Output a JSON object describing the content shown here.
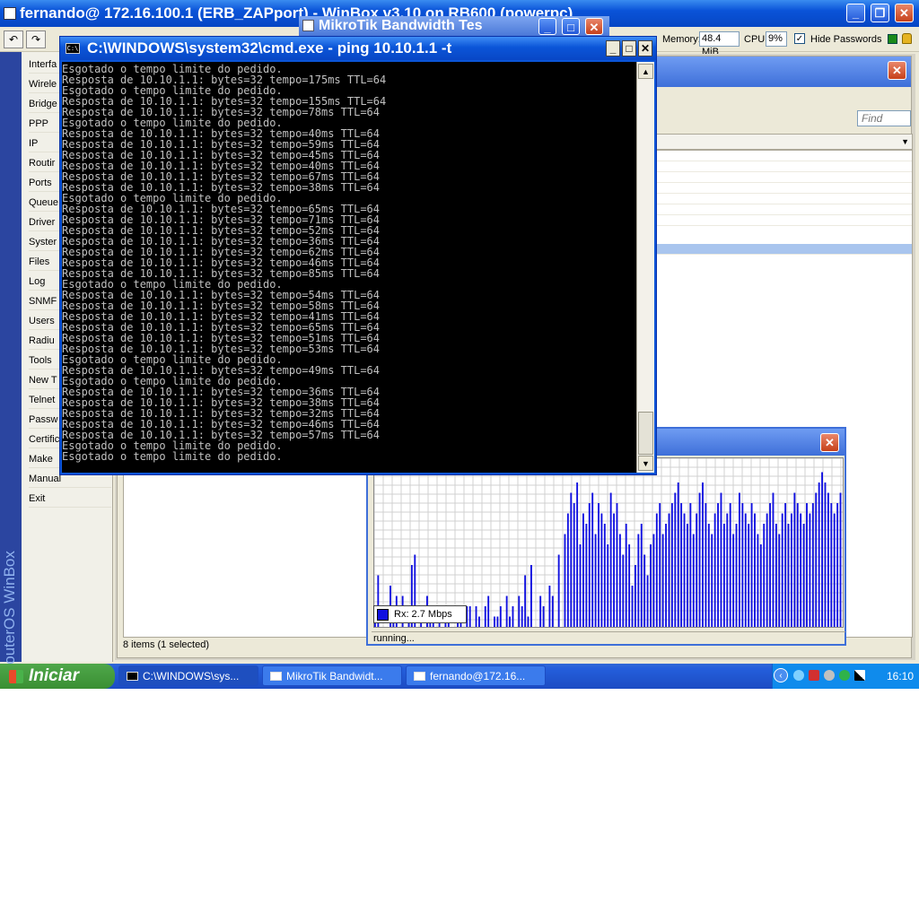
{
  "winbox": {
    "title": "fernando@ 172.16.100.1 (ERB_ZAPport) - WinBox v3.10 on RB600 (powerpc)",
    "toolbar": {
      "undo_icon": "undo-icon",
      "redo_icon": "redo-icon",
      "memory_label": "Memory:",
      "memory_value": "48.4 MiB",
      "cpu_label": "CPU:",
      "cpu_value": "9%",
      "hide_passwords_label": "Hide Passwords"
    },
    "brand": "RouterOS WinBox",
    "menu": [
      "Interfa",
      "Wirele",
      "Bridge",
      "PPP",
      "IP",
      "Routir",
      "Ports",
      "Queue",
      "Driver",
      "Syster",
      "Files",
      "Log",
      "SNMF",
      "Users",
      "Radiu",
      "Tools",
      "New T",
      "Telnet",
      "Passw",
      "Certific",
      "Make",
      "Manual",
      "Exit"
    ],
    "list": {
      "find_placeholder": "Find",
      "status": "8 items (1 selected)"
    }
  },
  "bandwidth": {
    "title": "MikroTik Bandwidth Tes",
    "legend": "Rx: 2.7 Mbps",
    "status": "running...",
    "colors": {
      "bar": "#1010e0",
      "grid": "#d0d0d0"
    },
    "chart_data": {
      "type": "bar",
      "series": [
        {
          "name": "Rx: 2.7 Mbps",
          "values": [
            2,
            5,
            0,
            0,
            0,
            4,
            1,
            3,
            0,
            3,
            0,
            1,
            6,
            7,
            0,
            2,
            0,
            3,
            1,
            2,
            0,
            1,
            0,
            2,
            1,
            0,
            0,
            1,
            1,
            0,
            2,
            2,
            0,
            2,
            1,
            0,
            2,
            3,
            0,
            1,
            1,
            2,
            0,
            3,
            1,
            2,
            0,
            3,
            2,
            5,
            1,
            6,
            0,
            0,
            3,
            2,
            0,
            4,
            3,
            0,
            7,
            0,
            9,
            11,
            13,
            12,
            14,
            8,
            11,
            10,
            12,
            13,
            9,
            12,
            11,
            10,
            8,
            13,
            11,
            12,
            9,
            7,
            10,
            8,
            4,
            6,
            9,
            10,
            7,
            5,
            8,
            9,
            11,
            12,
            9,
            10,
            11,
            12,
            13,
            14,
            12,
            11,
            10,
            12,
            9,
            11,
            13,
            14,
            12,
            10,
            9,
            11,
            12,
            13,
            10,
            11,
            12,
            9,
            10,
            13,
            12,
            11,
            10,
            12,
            11,
            9,
            8,
            10,
            11,
            12,
            13,
            10,
            9,
            11,
            12,
            10,
            11,
            13,
            12,
            11,
            10,
            12,
            11,
            12,
            13,
            14,
            15,
            14,
            13,
            12,
            11,
            12,
            13
          ]
        }
      ],
      "ylim": [
        0,
        16
      ]
    }
  },
  "cmd": {
    "title": "C:\\WINDOWS\\system32\\cmd.exe - ping 10.10.1.1 -t",
    "lines": [
      "Esgotado o tempo limite do pedido.",
      "Resposta de 10.10.1.1: bytes=32 tempo=175ms TTL=64",
      "Esgotado o tempo limite do pedido.",
      "Resposta de 10.10.1.1: bytes=32 tempo=155ms TTL=64",
      "Resposta de 10.10.1.1: bytes=32 tempo=78ms TTL=64",
      "Esgotado o tempo limite do pedido.",
      "Resposta de 10.10.1.1: bytes=32 tempo=40ms TTL=64",
      "Resposta de 10.10.1.1: bytes=32 tempo=59ms TTL=64",
      "Resposta de 10.10.1.1: bytes=32 tempo=45ms TTL=64",
      "Resposta de 10.10.1.1: bytes=32 tempo=40ms TTL=64",
      "Resposta de 10.10.1.1: bytes=32 tempo=67ms TTL=64",
      "Resposta de 10.10.1.1: bytes=32 tempo=38ms TTL=64",
      "Esgotado o tempo limite do pedido.",
      "Resposta de 10.10.1.1: bytes=32 tempo=65ms TTL=64",
      "Resposta de 10.10.1.1: bytes=32 tempo=71ms TTL=64",
      "Resposta de 10.10.1.1: bytes=32 tempo=52ms TTL=64",
      "Resposta de 10.10.1.1: bytes=32 tempo=36ms TTL=64",
      "Resposta de 10.10.1.1: bytes=32 tempo=62ms TTL=64",
      "Resposta de 10.10.1.1: bytes=32 tempo=46ms TTL=64",
      "Resposta de 10.10.1.1: bytes=32 tempo=85ms TTL=64",
      "Esgotado o tempo limite do pedido.",
      "Resposta de 10.10.1.1: bytes=32 tempo=54ms TTL=64",
      "Resposta de 10.10.1.1: bytes=32 tempo=58ms TTL=64",
      "Resposta de 10.10.1.1: bytes=32 tempo=41ms TTL=64",
      "Resposta de 10.10.1.1: bytes=32 tempo=65ms TTL=64",
      "Resposta de 10.10.1.1: bytes=32 tempo=51ms TTL=64",
      "Resposta de 10.10.1.1: bytes=32 tempo=53ms TTL=64",
      "Esgotado o tempo limite do pedido.",
      "Resposta de 10.10.1.1: bytes=32 tempo=49ms TTL=64",
      "Esgotado o tempo limite do pedido.",
      "Resposta de 10.10.1.1: bytes=32 tempo=36ms TTL=64",
      "Resposta de 10.10.1.1: bytes=32 tempo=38ms TTL=64",
      "Resposta de 10.10.1.1: bytes=32 tempo=32ms TTL=64",
      "Resposta de 10.10.1.1: bytes=32 tempo=46ms TTL=64",
      "Resposta de 10.10.1.1: bytes=32 tempo=57ms TTL=64",
      "Esgotado o tempo limite do pedido.",
      "Esgotado o tempo limite do pedido."
    ]
  },
  "taskbar": {
    "start_label": "Iniciar",
    "tasks": [
      "C:\\WINDOWS\\sys...",
      "MikroTik Bandwidt...",
      "fernando@172.16..."
    ],
    "clock": "16:10"
  }
}
